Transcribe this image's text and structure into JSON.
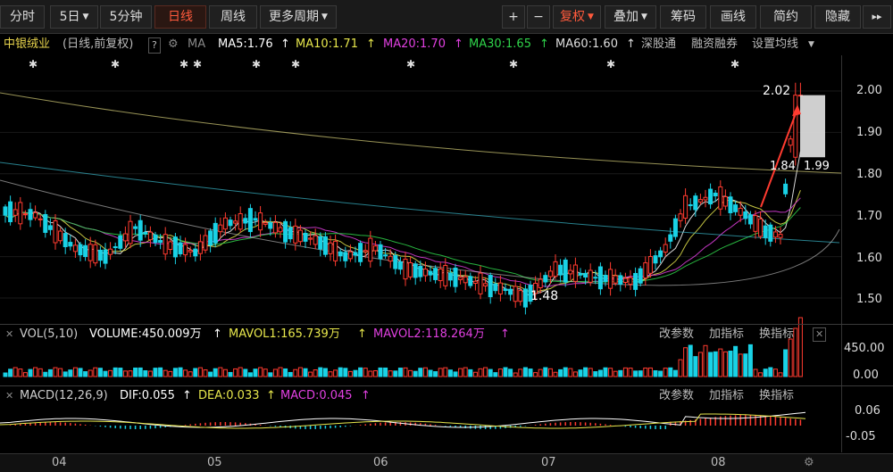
{
  "toolbar": {
    "period_buttons": [
      "分时",
      "5日",
      "5分钟",
      "日线",
      "周线",
      "更多周期"
    ],
    "zoom_in": "+",
    "zoom_out": "−",
    "fuquan": "复权",
    "overlay": "叠加",
    "chips": "筹码",
    "draw": "画线",
    "simple": "简约",
    "hide": "隐藏",
    "expand": "▸▸"
  },
  "info": {
    "stock_name": "中银绒业",
    "mode": "(日线,前复权)",
    "help": "?",
    "ma_label": "MA",
    "ma5": "MA5:1.76",
    "ma10": "MA10:1.71",
    "ma20": "MA20:1.70",
    "ma30": "MA30:1.65",
    "ma60": "MA60:1.60",
    "link1": "深股通",
    "link2": "融资融券",
    "link3": "设置均线"
  },
  "vol_head": {
    "title": "VOL(5,10)",
    "volume": "VOLUME:450.009万",
    "mavol1": "MAVOL1:165.739万",
    "mavol2": "MAVOL2:118.264万",
    "change_param": "改参数",
    "add_indicator": "加指标",
    "switch_indicator": "换指标"
  },
  "macd_head": {
    "title": "MACD(12,26,9)",
    "dif": "DIF:0.055",
    "dea": "DEA:0.033",
    "macd": "MACD:0.045",
    "change_param": "改参数",
    "add_indicator": "加指标",
    "switch_indicator": "换指标"
  },
  "annotations": {
    "high": "2.02",
    "low": "1.48",
    "latest_open": "1.84",
    "latest_close": "1.99"
  },
  "price_axis": [
    "2.00",
    "1.90",
    "1.80",
    "1.70",
    "1.60",
    "1.50"
  ],
  "vol_axis": [
    "450.00",
    "0.00"
  ],
  "macd_axis": [
    "0.06",
    "-0.05"
  ],
  "x_axis": [
    "04",
    "05",
    "06",
    "07",
    "08"
  ],
  "colors": {
    "up": "#ff3b30",
    "down": "#19d2e6",
    "ma5": "#ffffff",
    "ma10": "#e6e64c",
    "ma20": "#e040e0",
    "ma30": "#2fd34a",
    "ma60": "#cccccc"
  }
}
